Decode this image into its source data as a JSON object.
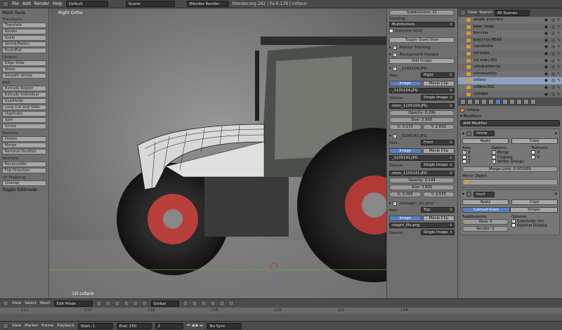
{
  "menubar": {
    "items": [
      "File",
      "Add",
      "Render",
      "Help"
    ],
    "layout": "Default",
    "scene": "Scene",
    "engine": "Blender Render",
    "info": "blender.org 262 | Fa:0-178 | cofano"
  },
  "toolshelf": {
    "title": "Mesh Tools",
    "sections": [
      {
        "label": "Transform:",
        "buttons": [
          "Translate",
          "Rotate",
          "Scale",
          "Shrink/Fatten",
          "Push/Pull"
        ]
      },
      {
        "label": "Deform:",
        "buttons": [
          "Edge Slide",
          "Noise",
          "Smooth Vertex"
        ]
      },
      {
        "label": "Add:",
        "buttons": [
          "Extrude Region",
          "Extrude Individual",
          "Subdivide",
          "Loop Cut and Slide",
          "Duplicate",
          "Spin",
          "Screw"
        ]
      },
      {
        "label": "Remove:",
        "buttons": [
          "Delete",
          "Merge",
          "Remove Doubles"
        ]
      },
      {
        "label": "Normals:",
        "buttons": [
          "Recalculate",
          "Flip Direction"
        ]
      },
      {
        "label": "UV Mapping:",
        "buttons": [
          "Unwrap"
        ]
      }
    ],
    "toggle": "Toggle Editmode"
  },
  "viewport": {
    "label": "Right Ortho",
    "object": "(2) cofano"
  },
  "npanel": {
    "subdiv": "Subdivisions: 21",
    "shading_label": "Shading:",
    "shading": "Multitexture",
    "textured_solid": "Textured Solid",
    "toggle_quad": "Toggle Quad View",
    "motion": "Motion Tracking",
    "bg": "Background Images",
    "add_image": "Add Image",
    "images": [
      {
        "name": "_1105104.JPG",
        "axis": "Right",
        "file": "_1105104.JPG",
        "source": "Single Image",
        "path": "stem_1105104.JPG",
        "opacity": "Opacity: 0.299",
        "size": "Size: 3.800",
        "x": "X: 0.170",
        "y": "Y: 2.650"
      },
      {
        "name": "_1105141.JPG",
        "axis": "Front",
        "file": "_1105141.JPG",
        "source": "Single Image",
        "path": "stem_1105141.JPG",
        "opacity": "Opacity: 0.144",
        "size": "Size: 3.800",
        "x": "X: 0.090",
        "y": "Y: 2.535"
      },
      {
        "name": "contagiri_illu.png",
        "axis": "Top",
        "file": "",
        "source": "Single Image",
        "path": "ntagiri_illu.png"
      }
    ],
    "axis_label": "Axis:",
    "image_tab": "Image",
    "clip_tab": "Movie Clip",
    "source_label": "Source:"
  },
  "outliner": {
    "view": "View",
    "search": "Search",
    "scope": "All Scenes",
    "items": [
      "assale anteriore",
      "base_targa",
      "boccola",
      "bracci su REAR",
      "candelette",
      "cili stabi",
      "cili stabi.001",
      "cilindrantenna",
      "cilindriarduo",
      "cofano",
      "cofano.001",
      "collidsA"
    ]
  },
  "properties": {
    "object": "cofano",
    "modifiers_label": "Modifiers",
    "add_modifier": "Add Modifier",
    "mirror": {
      "name": "mirror",
      "apply": "Apply",
      "copy": "Copy",
      "axis": "Axis:",
      "options": "Options:",
      "textures": "Textures:",
      "x": "X",
      "y": "Y",
      "z": "Z",
      "merge": "Merge",
      "clipping": "Clipping",
      "vertex_groups": "Vertex Groups",
      "u": "U",
      "v": "V",
      "merge_limit": "Merge Limit: 0.001000",
      "mirror_object": "Mirror Object:"
    },
    "subsurf": {
      "name": "tsurf",
      "apply": "Apply",
      "copy": "Copy",
      "catmull": "Catmull-Clark",
      "simple": "Simple",
      "subdivisions": "Subdivisions:",
      "options": "Options:",
      "view": "View: 3",
      "render": "Render: 2",
      "subdivide_uvs": "Subdivide UVs",
      "optimal": "Optimal Display"
    }
  },
  "header3d": {
    "items": [
      "View",
      "Select",
      "Mesh"
    ],
    "mode": "Edit Mode",
    "orientation": "Global"
  },
  "timeline": {
    "menu": [
      "View",
      "Marker",
      "Frame",
      "Playback"
    ],
    "start": "Start: 1",
    "end": "End: 250",
    "current": "2",
    "sync": "No Sync",
    "ticks": [
      "112",
      "114",
      "116",
      "118",
      "120",
      "122",
      "124"
    ]
  }
}
